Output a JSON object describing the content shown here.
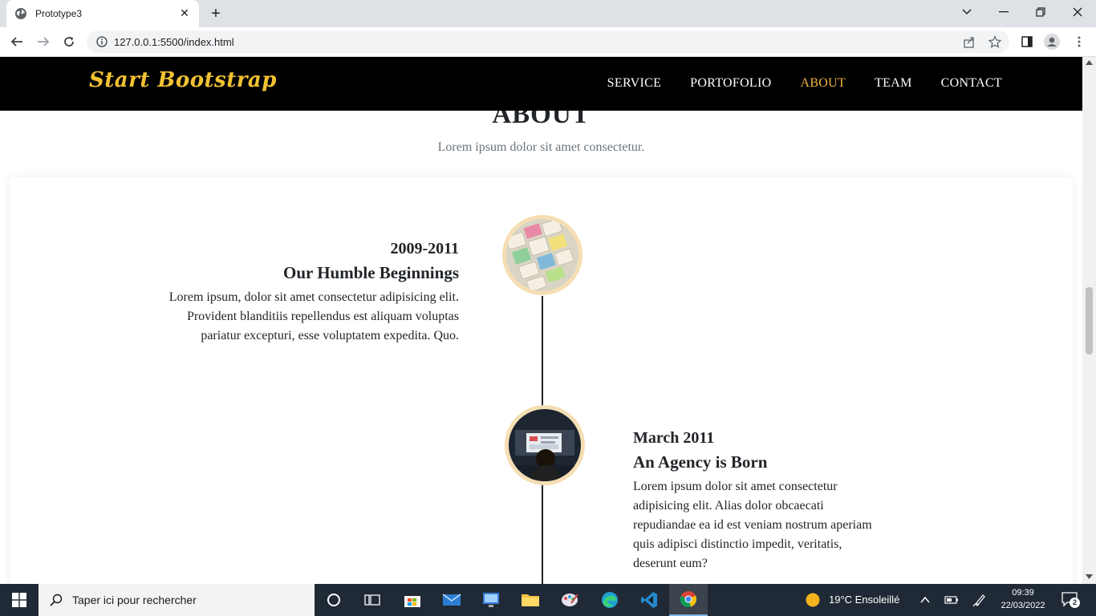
{
  "browser": {
    "tab_title": "Prototype3",
    "url": "127.0.0.1:5500/index.html"
  },
  "site": {
    "brand": "Start Bootstrap",
    "nav": [
      "SERVICE",
      "PORTOFOLIO",
      "ABOUT",
      "TEAM",
      "CONTACT"
    ],
    "active_nav": "ABOUT",
    "accent_color": "#f2b640",
    "brand_color": "#f2c232"
  },
  "about": {
    "title": "ABOUT",
    "subtitle": "Lorem ipsum dolor sit amet consectetur."
  },
  "timeline": [
    {
      "date": "2009-2011",
      "heading": "Our Humble Beginnings",
      "body": "Lorem ipsum, dolor sit amet consectetur adipisicing elit. Provident blanditiis repellendus est aliquam voluptas pariatur excepturi, esse voluptatem expedita. Quo.",
      "image": "wireframe-sketches-photo"
    },
    {
      "date": "March 2011",
      "heading": "An Agency is Born",
      "body": "Lorem ipsum dolor sit amet consectetur adipisicing elit. Alias dolor obcaecati repudiandae ea id est veniam nostrum aperiam quis adipisci distinctio impedit, veritatis, deserunt eum?",
      "image": "person-at-monitor-photo"
    }
  ],
  "taskbar": {
    "search_placeholder": "Taper ici pour rechercher",
    "weather": "19°C  Ensoleillé",
    "time": "09:39",
    "date": "22/03/2022",
    "notification_count": "2"
  }
}
